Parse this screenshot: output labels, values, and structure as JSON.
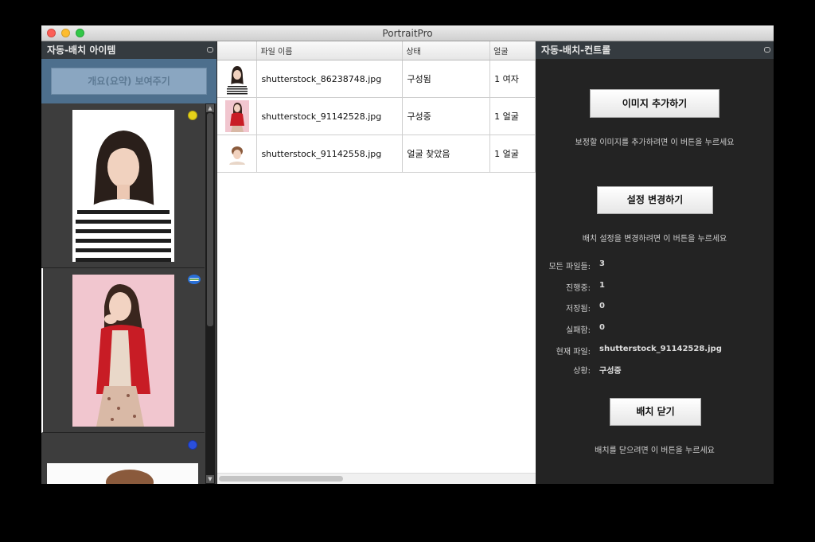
{
  "window": {
    "title": "PortraitPro"
  },
  "left_panel": {
    "header": "자동-배치 아이템",
    "summary_button": "개요(요약) 보여주기",
    "thumbnails": [
      {
        "status_color": "#e6d21a",
        "status": "yellow-dot"
      },
      {
        "status_color": "#2a6fd6",
        "status": "globe-icon"
      },
      {
        "status_color": "#2a4fdc",
        "status": "blue-dot"
      }
    ]
  },
  "table": {
    "columns": [
      "",
      "파일 이름",
      "상태",
      "얼굴"
    ],
    "rows": [
      {
        "file": "shutterstock_86238748.jpg",
        "status": "구성됨",
        "faces": "1 여자"
      },
      {
        "file": "shutterstock_91142528.jpg",
        "status": "구성중",
        "faces": "1 얼굴"
      },
      {
        "file": "shutterstock_91142558.jpg",
        "status": "얼굴 찾았음",
        "faces": "1 얼굴"
      }
    ]
  },
  "right_panel": {
    "header": "자동-배치-컨트롤",
    "add_button": "이미지 추가하기",
    "add_hint": "보정할 이미지를 추가하려면 이 버튼을 누르세요",
    "settings_button": "설정 변경하기",
    "settings_hint": "배치 설정을 변경하려면 이 버튼을 누르세요",
    "stats": [
      {
        "label": "모든 파일들:",
        "value": "3"
      },
      {
        "label": "진행중:",
        "value": "1"
      },
      {
        "label": "저장됨:",
        "value": "0"
      },
      {
        "label": "실패함:",
        "value": "0"
      },
      {
        "label": "현재 파일:",
        "value": "shutterstock_91142528.jpg"
      },
      {
        "label": "상황:",
        "value": "구성중"
      }
    ],
    "close_button": "배치 닫기",
    "close_hint": "배치를 닫으려면 이 버튼을 누르세요"
  }
}
